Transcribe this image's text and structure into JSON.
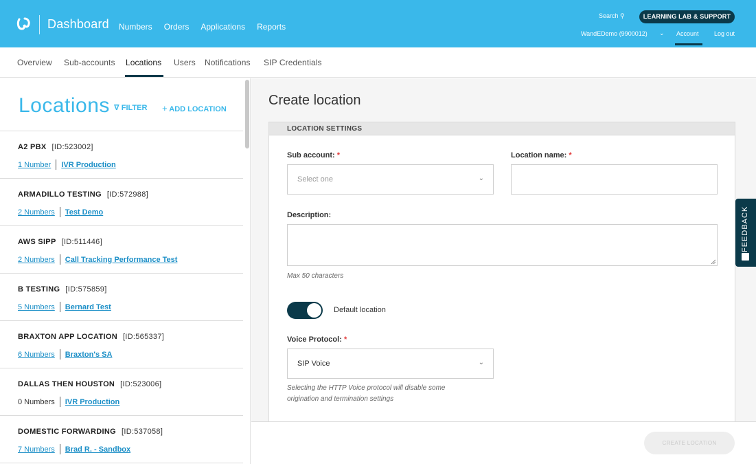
{
  "header": {
    "brand": "Dashboard",
    "nav": [
      "Numbers",
      "Orders",
      "Applications",
      "Reports"
    ],
    "search_label": "Search",
    "lab_button": "LEARNING LAB & SUPPORT",
    "account_selector": "WandEDemo (9900012)",
    "account_link": "Account",
    "logout": "Log out"
  },
  "subnav": [
    "Overview",
    "Sub-accounts",
    "Locations",
    "Users",
    "Notifications",
    "SIP Credentials"
  ],
  "subnav_active": "Locations",
  "sidebar": {
    "title": "Locations",
    "filter_label": "FILTER",
    "add_label": "ADD LOCATION",
    "locations": [
      {
        "name": "A2 PBX",
        "id": "[ID:523002]",
        "numbers": "1 Number",
        "account": "IVR Production"
      },
      {
        "name": "ARMADILLO TESTING",
        "id": "[ID:572988]",
        "numbers": "2 Numbers",
        "account": "Test Demo"
      },
      {
        "name": "AWS SIPP",
        "id": "[ID:511446]",
        "numbers": "2 Numbers",
        "account": "Call Tracking Performance Test"
      },
      {
        "name": "B TESTING",
        "id": "[ID:575859]",
        "numbers": "5 Numbers",
        "account": "Bernard Test"
      },
      {
        "name": "BRAXTON APP LOCATION",
        "id": "[ID:565337]",
        "numbers": "6 Numbers",
        "account": "Braxton's SA"
      },
      {
        "name": "DALLAS THEN HOUSTON",
        "id": "[ID:523006]",
        "numbers": "0 Numbers",
        "account": "IVR Production"
      },
      {
        "name": "DOMESTIC FORWARDING",
        "id": "[ID:537058]",
        "numbers": "7 Numbers",
        "account": "Brad R. - Sandbox"
      }
    ]
  },
  "form": {
    "title": "Create location",
    "section": "LOCATION SETTINGS",
    "sub_account_label": "Sub account:",
    "sub_account_placeholder": "Select one",
    "location_name_label": "Location name:",
    "location_name_value": "",
    "description_label": "Description:",
    "description_value": "",
    "description_hint": "Max 50 characters",
    "default_location_label": "Default location",
    "default_location_on": true,
    "voice_protocol_label": "Voice Protocol:",
    "voice_protocol_value": "SIP Voice",
    "voice_protocol_hint_1": "Selecting the HTTP Voice protocol will disable some",
    "voice_protocol_hint_2": "origination and termination settings",
    "required_mark": "*",
    "submit": "CREATE LOCATION"
  },
  "feedback_tab": "FEEDBACK",
  "colors": {
    "brand_blue": "#3ab8ea",
    "dark_navy": "#0b3a4a",
    "link_blue": "#1c8fc7",
    "required_red": "#e23b3b"
  },
  "icons": [
    "logo-icon",
    "search-icon",
    "chevron-down-icon",
    "filter-icon",
    "plus-icon",
    "feedback-icon"
  ]
}
